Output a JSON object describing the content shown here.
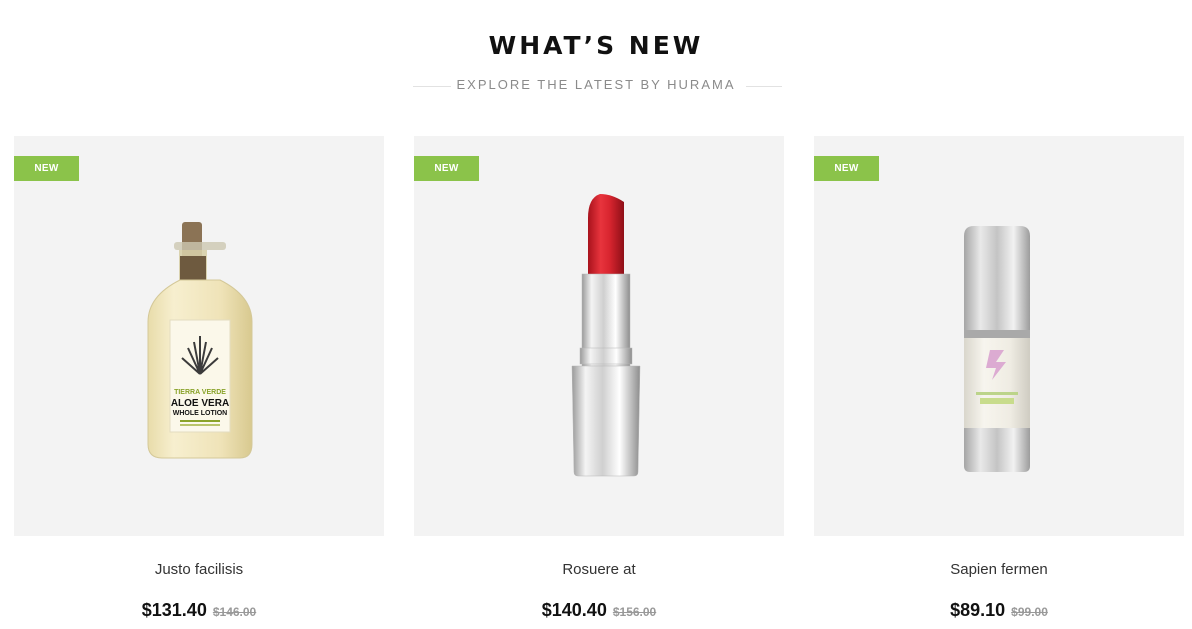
{
  "section": {
    "title": "WHAT’S NEW",
    "subtitle": "EXPLORE THE LATEST BY HURAMA"
  },
  "products": [
    {
      "badge": "NEW",
      "name": "Justo facilisis",
      "price": "$131.40",
      "old_price": "$146.00",
      "image": "aloe-vera-lotion-bottle",
      "label": {
        "brand": "TIERRA VERDE",
        "title_line1": "ALOE VERA",
        "title_line2": "WHOLE LOTION"
      }
    },
    {
      "badge": "NEW",
      "name": "Rosuere at",
      "price": "$140.40",
      "old_price": "$156.00",
      "image": "red-lipstick"
    },
    {
      "badge": "NEW",
      "name": "Sapien fermen",
      "price": "$89.10",
      "old_price": "$99.00",
      "image": "silver-pump-serum-bottle"
    }
  ],
  "colors": {
    "badge": "#8bc34a",
    "card_bg": "#f3f3f3",
    "lipstick_red": "#d8252f"
  }
}
